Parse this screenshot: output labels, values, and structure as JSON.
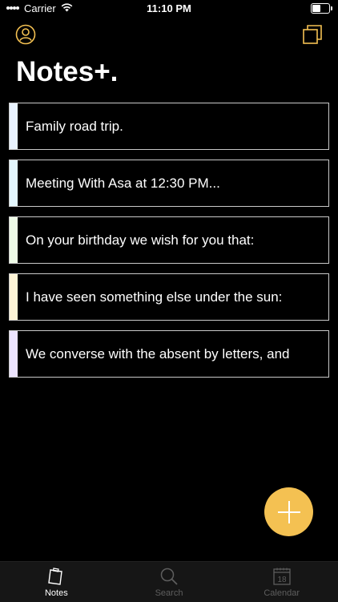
{
  "status": {
    "carrier": "Carrier",
    "time": "11:10 PM",
    "battery_level": 0.55
  },
  "header": {
    "title": "Notes+."
  },
  "colors": {
    "accent": "#f4c152",
    "tab_active": "#ffffff",
    "tab_inactive": "#5e5e5e"
  },
  "notes": [
    {
      "text": "Family road trip.",
      "color": "#e9f3ff"
    },
    {
      "text": "Meeting With Asa at 12:30 PM...",
      "color": "#e3f6fd"
    },
    {
      "text": "On your birthday we wish for you that:",
      "color": "#eefbe7"
    },
    {
      "text": "I have seen something else under the sun:",
      "color": "#fdf4d6"
    },
    {
      "text": "We converse with the absent by letters, and",
      "color": "#ede4ff"
    }
  ],
  "tabs": [
    {
      "label": "Notes",
      "icon": "notes-icon",
      "active": true
    },
    {
      "label": "Search",
      "icon": "search-icon",
      "active": false
    },
    {
      "label": "Calendar",
      "icon": "calendar-icon",
      "active": false,
      "day": "18"
    }
  ]
}
